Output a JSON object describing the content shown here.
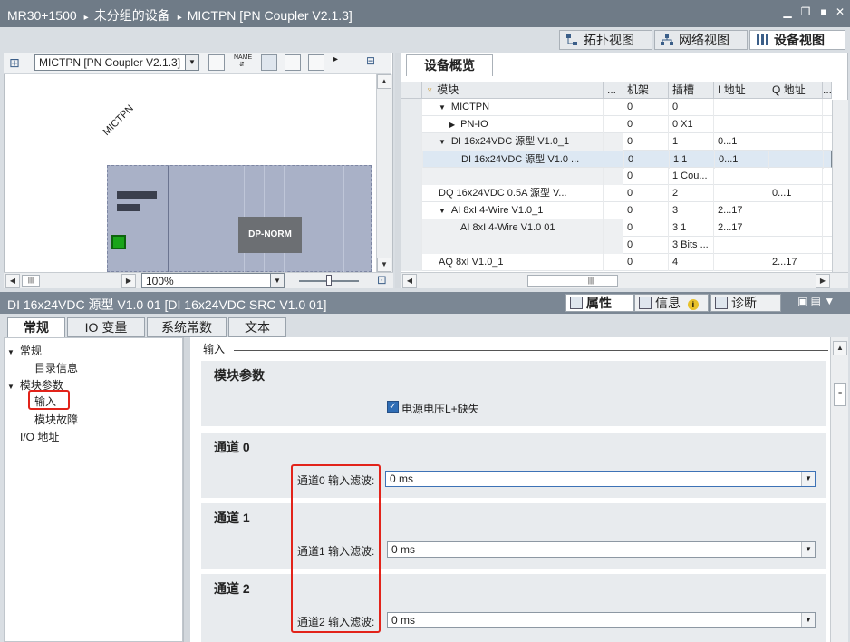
{
  "titlebar": {
    "crumbs": [
      "MR30+1500",
      "未分组的设备",
      "MICTPN [PN Coupler V2.1.3]"
    ],
    "sep": "▸"
  },
  "view_tabs": [
    {
      "label": "拓扑视图",
      "icon": "topology-view-icon"
    },
    {
      "label": "网络视图",
      "icon": "network-view-icon"
    },
    {
      "label": "设备视图",
      "icon": "device-view-icon",
      "active": true
    }
  ],
  "graphic": {
    "device_select": "MICTPN [PN Coupler V2.1.3]",
    "device_label": "MICTPN",
    "module_label": "DP-NORM",
    "zoom": "100%"
  },
  "overview": {
    "tab": "设备概览",
    "headers": [
      "模块",
      "...",
      "机架",
      "插槽",
      "I 地址",
      "Q 地址",
      "..."
    ],
    "rows": [
      {
        "indent": 1,
        "toggle": "▼",
        "module": "MICTPN",
        "rack": "0",
        "slot": "0",
        "i": "",
        "q": ""
      },
      {
        "indent": 2,
        "toggle": "▶",
        "module": "PN-IO",
        "rack": "0",
        "slot": "0 X1",
        "i": "",
        "q": ""
      },
      {
        "indent": 1,
        "toggle": "▼",
        "module": "DI 16x24VDC 源型 V1.0_1",
        "rack": "0",
        "slot": "1",
        "i": "0...1",
        "q": "",
        "gray": true
      },
      {
        "indent": 3,
        "toggle": "",
        "module": "DI 16x24VDC 源型 V1.0 ...",
        "rack": "0",
        "slot": "1 1",
        "i": "0...1",
        "q": "",
        "selected": true
      },
      {
        "indent": 3,
        "toggle": "",
        "module": "",
        "rack": "0",
        "slot": "1 Cou...",
        "i": "",
        "q": "",
        "gray": true
      },
      {
        "indent": 1,
        "toggle": "",
        "module": "DQ 16x24VDC 0.5A 源型 V...",
        "rack": "0",
        "slot": "2",
        "i": "",
        "q": "0...1"
      },
      {
        "indent": 1,
        "toggle": "▼",
        "module": "AI 8xI 4-Wire V1.0_1",
        "rack": "0",
        "slot": "3",
        "i": "2...17",
        "q": ""
      },
      {
        "indent": 3,
        "toggle": "",
        "module": "AI 8xI 4-Wire V1.0 01",
        "rack": "0",
        "slot": "3 1",
        "i": "2...17",
        "q": "",
        "gray": true
      },
      {
        "indent": 3,
        "toggle": "",
        "module": "",
        "rack": "0",
        "slot": "3 Bits ...",
        "i": "",
        "q": "",
        "gray": true
      },
      {
        "indent": 1,
        "toggle": "",
        "module": "AQ 8xI V1.0_1",
        "rack": "0",
        "slot": "4",
        "i": "",
        "q": "2...17"
      }
    ]
  },
  "inspector": {
    "title": "DI 16x24VDC 源型 V1.0 01 [DI 16x24VDC SRC V1.0 01]",
    "tabs": [
      {
        "label": "属性",
        "icon": "properties-icon"
      },
      {
        "label": "信息",
        "icon": "info-icon"
      },
      {
        "label": "诊断",
        "icon": "diagnostics-icon"
      }
    ],
    "subtabs": [
      "常规",
      "IO 变量",
      "系统常数",
      "文本"
    ],
    "tree": [
      {
        "label": "常规",
        "toggle": "▼",
        "level": 0
      },
      {
        "label": "目录信息",
        "toggle": "",
        "level": 1
      },
      {
        "label": "模块参数",
        "toggle": "▼",
        "level": 0
      },
      {
        "label": "输入",
        "toggle": "",
        "level": 1
      },
      {
        "label": "模块故障",
        "toggle": "",
        "level": 1
      },
      {
        "label": "I/O 地址",
        "toggle": "",
        "level": 0
      }
    ],
    "section_heading": "输入",
    "module_params": {
      "title": "模块参数",
      "checkbox_label": "电源电压L+缺失",
      "checked": true
    },
    "channels": [
      {
        "title": "通道 0",
        "label": "通道0 输入滤波:",
        "value": "0 ms"
      },
      {
        "title": "通道 1",
        "label": "通道1 输入滤波:",
        "value": "0 ms"
      },
      {
        "title": "通道 2",
        "label": "通道2 输入滤波:",
        "value": "0 ms"
      }
    ]
  },
  "colors": {
    "highlight": "#e2231a",
    "accent": "#2f6db5",
    "header": "#6f7b87"
  }
}
